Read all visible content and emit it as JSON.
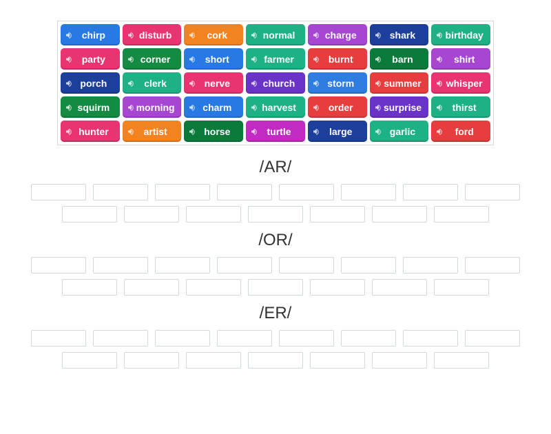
{
  "word_bank": {
    "rows": [
      [
        {
          "label": "chirp",
          "color": "c-blue"
        },
        {
          "label": "disturb",
          "color": "c-pink"
        },
        {
          "label": "cork",
          "color": "c-orange"
        },
        {
          "label": "normal",
          "color": "c-teal"
        },
        {
          "label": "charge",
          "color": "c-purple"
        },
        {
          "label": "shark",
          "color": "c-navy"
        },
        {
          "label": "birthday",
          "color": "c-teal"
        }
      ],
      [
        {
          "label": "party",
          "color": "c-pink"
        },
        {
          "label": "corner",
          "color": "c-green"
        },
        {
          "label": "short",
          "color": "c-blue"
        },
        {
          "label": "farmer",
          "color": "c-teal"
        },
        {
          "label": "burnt",
          "color": "c-red"
        },
        {
          "label": "barn",
          "color": "c-dkgreen"
        },
        {
          "label": "shirt",
          "color": "c-purple"
        }
      ],
      [
        {
          "label": "porch",
          "color": "c-navy"
        },
        {
          "label": "clerk",
          "color": "c-teal"
        },
        {
          "label": "nerve",
          "color": "c-pink"
        },
        {
          "label": "church",
          "color": "c-violet"
        },
        {
          "label": "storm",
          "color": "c-azure"
        },
        {
          "label": "summer",
          "color": "c-red"
        },
        {
          "label": "whisper",
          "color": "c-pink"
        }
      ],
      [
        {
          "label": "squirm",
          "color": "c-green"
        },
        {
          "label": "morning",
          "color": "c-purple"
        },
        {
          "label": "charm",
          "color": "c-blue"
        },
        {
          "label": "harvest",
          "color": "c-teal"
        },
        {
          "label": "order",
          "color": "c-red"
        },
        {
          "label": "surprise",
          "color": "c-violet"
        },
        {
          "label": "thirst",
          "color": "c-teal"
        }
      ],
      [
        {
          "label": "hunter",
          "color": "c-pink"
        },
        {
          "label": "artist",
          "color": "c-orange"
        },
        {
          "label": "horse",
          "color": "c-dkgreen"
        },
        {
          "label": "turtle",
          "color": "c-magenta"
        },
        {
          "label": "large",
          "color": "c-navy"
        },
        {
          "label": "garlic",
          "color": "c-teal"
        },
        {
          "label": "ford",
          "color": "c-red"
        }
      ]
    ]
  },
  "categories": [
    {
      "title": "/AR/",
      "slots_row1": 8,
      "slots_row2": 7
    },
    {
      "title": "/OR/",
      "slots_row1": 8,
      "slots_row2": 7
    },
    {
      "title": "/ER/",
      "slots_row1": 8,
      "slots_row2": 7
    }
  ]
}
